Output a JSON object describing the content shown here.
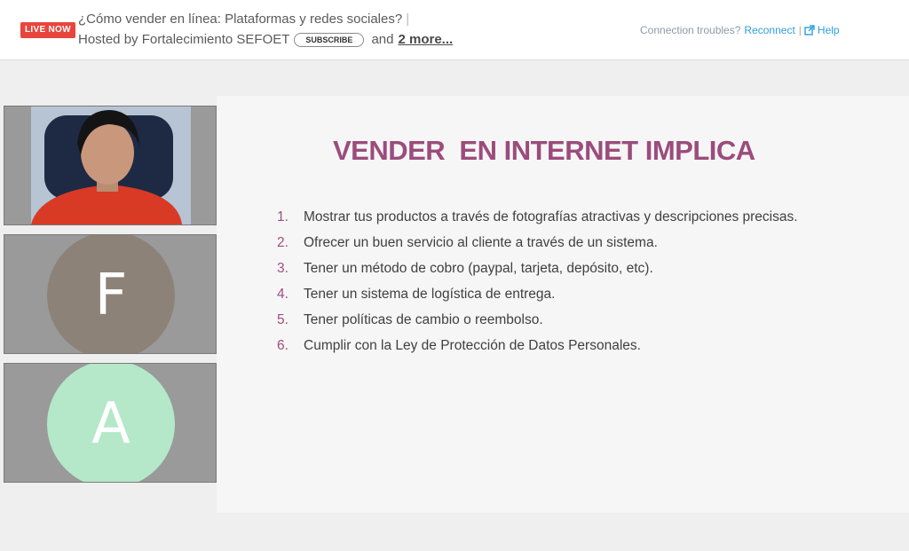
{
  "header": {
    "live_label": "LIVE NOW",
    "title": "¿Cómo vender en línea: Plataformas y redes sociales?",
    "hosted_by": "Hosted by Fortalecimiento SEFOET",
    "subscribe_label": "SUBSCRIBE",
    "and_label": "and",
    "more_label": "2 more...",
    "connection_text": "Connection troubles?",
    "reconnect_label": "Reconnect",
    "help_label": "Help"
  },
  "participants": [
    {
      "type": "video",
      "initial": ""
    },
    {
      "type": "avatar",
      "initial": "F",
      "color": "#8c8278"
    },
    {
      "type": "avatar",
      "initial": "A",
      "color": "#b4e8c8"
    }
  ],
  "slide": {
    "title": "VENDER  EN INTERNET IMPLICA",
    "items": [
      {
        "num": "1.",
        "text": "Mostrar tus productos a través de fotografías atractivas y descripciones precisas."
      },
      {
        "num": "2.",
        "text": "Ofrecer un buen servicio al cliente a través de un sistema."
      },
      {
        "num": "3.",
        "text": "Tener un método de cobro (paypal, tarjeta, depósito, etc)."
      },
      {
        "num": "4.",
        "text": "Tener un sistema de logística de entrega."
      },
      {
        "num": "5.",
        "text": "Tener políticas de cambio o reembolso."
      },
      {
        "num": "6.",
        "text": "Cumplir con la Ley de Protección de Datos Personales."
      }
    ]
  },
  "colors": {
    "live_badge": "#e8453c",
    "link": "#2ea0dc",
    "slide_title": "#9b4c7c"
  }
}
